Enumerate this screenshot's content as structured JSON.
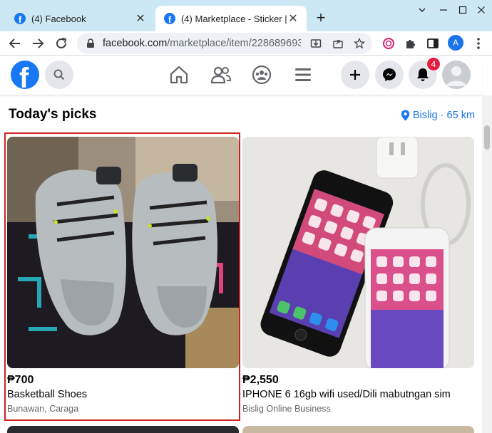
{
  "browser": {
    "tabs": [
      {
        "title": "(4) Facebook",
        "active": false
      },
      {
        "title": "(4) Marketplace - Sticker | Fa",
        "active": true
      }
    ],
    "new_tab_symbol": "+",
    "url_host": "facebook.com",
    "url_path": "/marketplace/item/228689693...",
    "profile_initial": "A"
  },
  "header": {
    "logo_letter": "f",
    "notification_count": "4",
    "icons": [
      "search-icon",
      "home-icon",
      "friends-icon",
      "groups-icon",
      "menu-icon",
      "create-icon",
      "messenger-icon",
      "bell-icon"
    ]
  },
  "marketplace": {
    "section_title": "Today's picks",
    "location": "Bislig · 65 km",
    "listings": [
      {
        "price": "₱700",
        "title": "Basketball Shoes",
        "location": "Bunawan, Caraga",
        "highlighted": true
      },
      {
        "price": "₱2,550",
        "title": "IPHONE 6 16gb wifi used/Dili mabutngan sim",
        "location": "Bislig Online Business",
        "highlighted": false
      }
    ]
  },
  "colors": {
    "brand": "#1877f2",
    "tabstrip": "#cce8f4",
    "highlight": "#d21f1f",
    "badge": "#e41e3f"
  }
}
